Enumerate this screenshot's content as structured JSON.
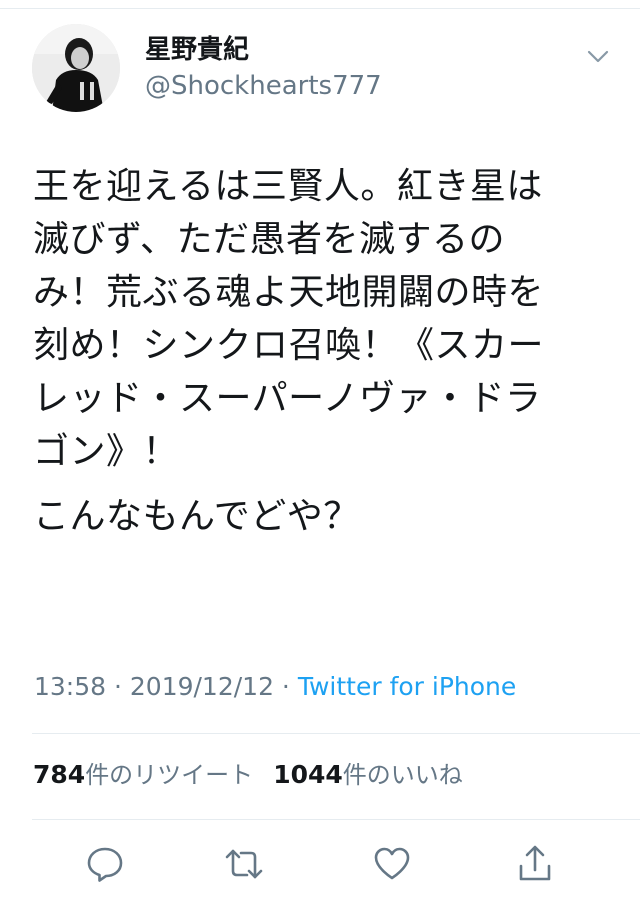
{
  "tweet": {
    "display_name": "星野貴紀",
    "handle": "@Shockhearts777",
    "text_lines": [
      "王を迎えるは三賢人。紅き星は",
      "滅びず、ただ愚者を滅するの",
      "み！荒ぶる魂よ天地開闢の時を",
      "刻め！シンクロ召喚！《スカー",
      "レッド・スーパーノヴァ・ドラ",
      "ゴン》！"
    ],
    "text_line2": "こんなもんでどや？",
    "time": "13:58",
    "date": "2019/12/12",
    "separator": " · ",
    "source": "Twitter for iPhone"
  },
  "stats": {
    "retweets_count": "784",
    "retweets_label": "件のリツイート",
    "likes_count": "1044",
    "likes_label": "件のいいね"
  },
  "icons": {
    "chevron": "chevron-down-icon",
    "reply": "reply-icon",
    "retweet": "retweet-icon",
    "like": "heart-icon",
    "share": "share-icon"
  },
  "colors": {
    "text": "#14171a",
    "secondary": "#657786",
    "link": "#1da1f2",
    "border": "#e6ecf0"
  }
}
